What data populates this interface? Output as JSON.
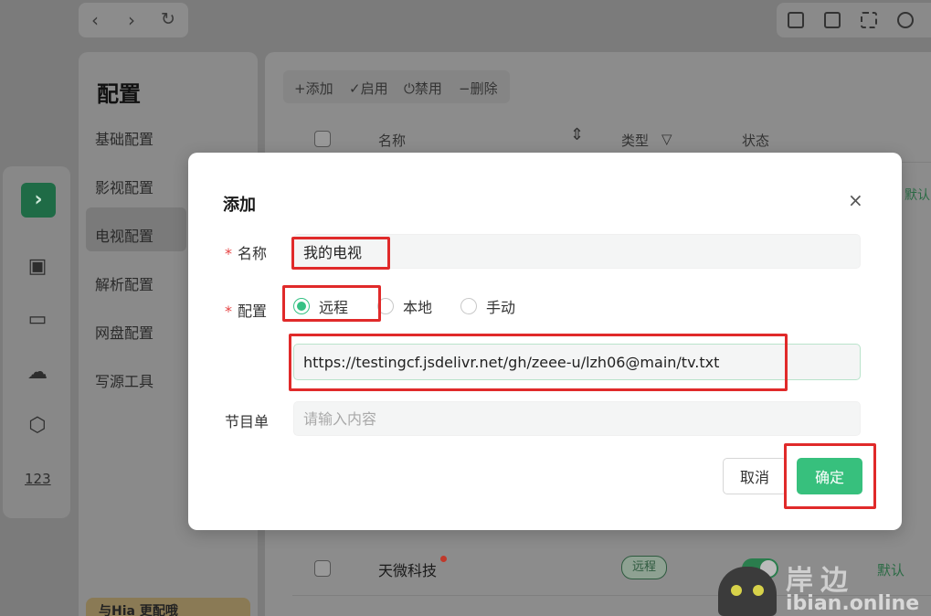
{
  "config_panel": {
    "title": "配置",
    "items": [
      "基础配置",
      "影视配置",
      "电视配置",
      "解析配置",
      "网盘配置",
      "写源工具"
    ],
    "promo": "与Hia 更配哦"
  },
  "table": {
    "toolbar": {
      "add": "+添加",
      "enable": "✓启用",
      "disable": "⏻禁用",
      "delete": "−删除"
    },
    "headers": {
      "name": "名称",
      "type": "类型",
      "status": "状态"
    },
    "visible_row": {
      "name": "天微科技",
      "type": "远程",
      "action": "默认"
    },
    "side_default": "默认"
  },
  "dialog": {
    "title": "添加",
    "name_label": "名称",
    "name_value": "我的电视",
    "config_label": "配置",
    "config_options": [
      "远程",
      "本地",
      "手动"
    ],
    "config_selected": "远程",
    "url_value": "https://testingcf.jsdelivr.net/gh/zeee-u/lzh06@main/tv.txt",
    "program_label": "节目单",
    "program_placeholder": "请输入内容",
    "cancel_label": "取消",
    "ok_label": "确定",
    "close_glyph": "×"
  },
  "watermark": {
    "line1": "岸边",
    "line2": "ibian.online"
  },
  "colors": {
    "accent": "#37c07d",
    "highlight": "#e02a2a",
    "required": "#e64545"
  },
  "icons": {
    "back": "back-icon",
    "forward": "forward-icon",
    "refresh": "refresh-icon",
    "close": "close-icon"
  }
}
